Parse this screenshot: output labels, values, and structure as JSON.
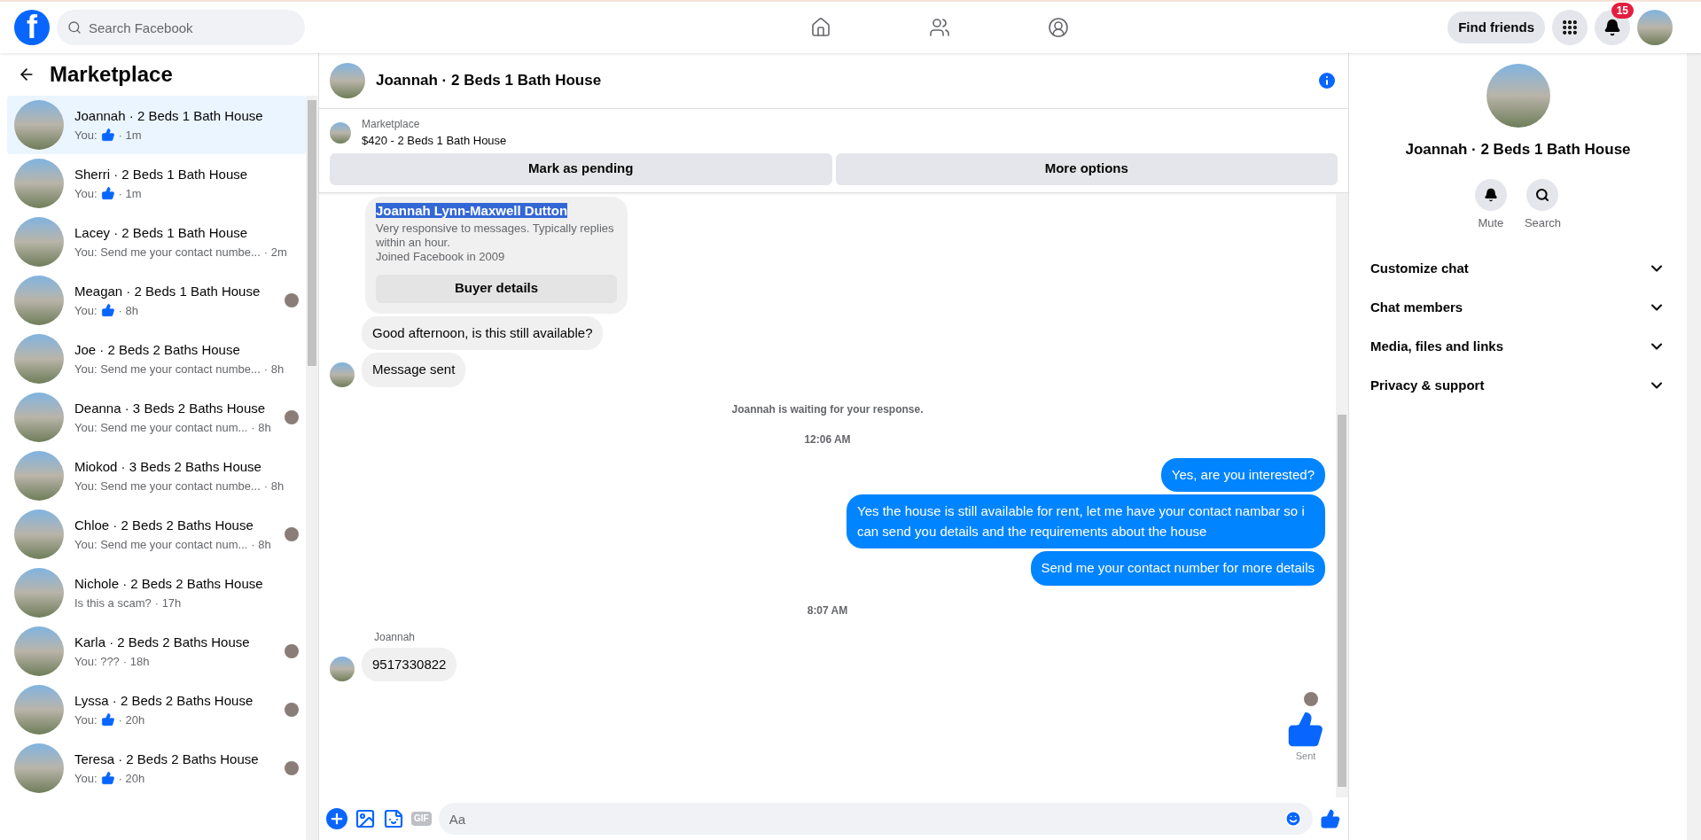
{
  "topbar": {
    "logo": "f",
    "search_placeholder": "Search Facebook",
    "find_friends": "Find friends",
    "notification_count": "15"
  },
  "sidebar": {
    "title": "Marketplace",
    "conversations": [
      {
        "name": "Joannah · 2 Beds 1 Bath House",
        "preview": "You:",
        "like": true,
        "time": "· 1m",
        "seen": false,
        "selected": true
      },
      {
        "name": "Sherri · 2 Beds 1 Bath House",
        "preview": "You:",
        "like": true,
        "time": "· 1m",
        "seen": false,
        "selected": false
      },
      {
        "name": "Lacey · 2 Beds 1 Bath House",
        "preview": "You: Send me your contact numbe...",
        "like": false,
        "time": "· 2m",
        "seen": false,
        "selected": false
      },
      {
        "name": "Meagan · 2 Beds 1 Bath House",
        "preview": "You:",
        "like": true,
        "time": "· 8h",
        "seen": true,
        "selected": false
      },
      {
        "name": "Joe · 2 Beds 2 Baths House",
        "preview": "You: Send me your contact numbe...",
        "like": false,
        "time": "· 8h",
        "seen": false,
        "selected": false
      },
      {
        "name": "Deanna · 3 Beds 2 Baths House",
        "preview": "You: Send me your contact num...",
        "like": false,
        "time": "· 8h",
        "seen": true,
        "selected": false
      },
      {
        "name": "Miokod · 3 Beds 2 Baths House",
        "preview": "You: Send me your contact numbe...",
        "like": false,
        "time": "· 8h",
        "seen": false,
        "selected": false
      },
      {
        "name": "Chloe · 2 Beds 2 Baths House",
        "preview": "You: Send me your contact num...",
        "like": false,
        "time": "· 8h",
        "seen": true,
        "selected": false
      },
      {
        "name": "Nichole · 2 Beds 2 Baths House",
        "preview": "Is this a scam?",
        "like": false,
        "time": "· 17h",
        "seen": false,
        "selected": false
      },
      {
        "name": "Karla · 2 Beds 2 Baths House",
        "preview": "You: ???",
        "like": false,
        "time": "· 18h",
        "seen": true,
        "selected": false
      },
      {
        "name": "Lyssa · 2 Beds 2 Baths House",
        "preview": "You:",
        "like": true,
        "time": "· 20h",
        "seen": true,
        "selected": false
      },
      {
        "name": "Teresa · 2 Beds 2 Baths House",
        "preview": "You:",
        "like": true,
        "time": "· 20h",
        "seen": true,
        "selected": false
      }
    ]
  },
  "chat": {
    "title": "Joannah · 2 Beds 1 Bath House",
    "listing": {
      "source": "Marketplace",
      "item": "$420 - 2 Beds 1 Bath House",
      "buttons": [
        "Mark as pending",
        "More options"
      ]
    },
    "messages": [
      {
        "kind": "profile_card",
        "name": "Joannah Lynn-Maxwell Dutton",
        "highlighted": true,
        "lines": [
          "Very responsive to messages. Typically replies within an hour.",
          "Joined Facebook in 2009"
        ],
        "button": "Buyer details"
      },
      {
        "kind": "incoming",
        "text": "Good afternoon, is this still available?",
        "avatar": false
      },
      {
        "kind": "incoming",
        "text": "Message sent",
        "avatar": true
      },
      {
        "kind": "status",
        "text": "Joannah is waiting for your response."
      },
      {
        "kind": "time",
        "text": "12:06 AM"
      },
      {
        "kind": "outgoing",
        "text": "Yes, are you interested?"
      },
      {
        "kind": "outgoing",
        "text": "Yes the house is still available for rent, let me have your contact nambar so i can send you details and the requirements about the house"
      },
      {
        "kind": "outgoing",
        "text": "Send me your contact number for more details"
      },
      {
        "kind": "time",
        "text": "8:07 AM"
      },
      {
        "kind": "sender",
        "text": "Joannah"
      },
      {
        "kind": "incoming",
        "text": "9517330822",
        "avatar": true
      },
      {
        "kind": "seen"
      },
      {
        "kind": "like",
        "text": "Sent"
      }
    ],
    "composer": {
      "gif": "GIF",
      "placeholder": "Aa"
    }
  },
  "details": {
    "title": "Joannah · 2 Beds 1 Bath House",
    "actions": [
      "Mute",
      "Search"
    ],
    "sections": [
      {
        "label": "Customize chat",
        "expanded": false
      },
      {
        "label": "Chat members",
        "expanded": false
      },
      {
        "label": "Media, files and links",
        "expanded": false
      },
      {
        "label": "Privacy & support",
        "expanded": false
      }
    ]
  }
}
